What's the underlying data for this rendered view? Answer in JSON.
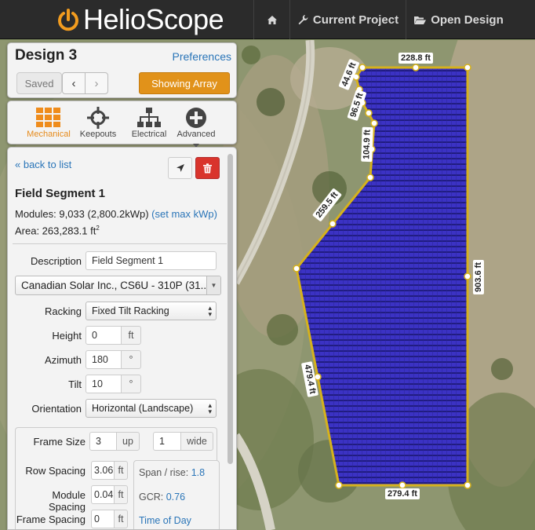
{
  "nav": {
    "brand": "HelioScope",
    "home_icon": "home-icon",
    "current_project_label": "Current Project",
    "open_design_label": "Open Design"
  },
  "design": {
    "title": "Design 3",
    "preferences_label": "Preferences",
    "saved_label": "Saved",
    "prev_label": "‹",
    "next_label": "›",
    "showing_array_label": "Showing Array"
  },
  "tabs": [
    {
      "label": "Mechanical",
      "icon": "grid-icon",
      "active": true
    },
    {
      "label": "Keepouts",
      "icon": "crosshair-icon",
      "active": false
    },
    {
      "label": "Electrical",
      "icon": "hierarchy-icon",
      "active": false
    },
    {
      "label": "Advanced",
      "icon": "plus-circle-icon",
      "active": false
    }
  ],
  "segment": {
    "back_label": "« back to list",
    "title": "Field Segment 1",
    "modules_prefix": "Modules: 9,033 (2,800.2kWp)",
    "set_max_label": "(set max kWp)",
    "area_text": "Area: 263,283.1 ft",
    "area_sup": "2",
    "description_label": "Description",
    "description_value": "Field Segment 1",
    "module_value": "Canadian Solar Inc., CS6U - 310P (31...",
    "racking_label": "Racking",
    "racking_value": "Fixed Tilt Racking",
    "height_label": "Height",
    "height_value": "0",
    "height_unit": "ft",
    "azimuth_label": "Azimuth",
    "azimuth_value": "180",
    "azimuth_unit": "°",
    "tilt_label": "Tilt",
    "tilt_value": "10",
    "tilt_unit": "°",
    "orientation_label": "Orientation",
    "orientation_value": "Horizontal (Landscape)",
    "frame_size_label": "Frame Size",
    "frame_up_value": "3",
    "frame_up_unit": "up",
    "frame_wide_value": "1",
    "frame_wide_unit": "wide",
    "row_spacing_label": "Row Spacing",
    "row_spacing_value": "3.06",
    "row_spacing_unit": "ft",
    "module_spacing_label": "Module Spacing",
    "module_spacing_value": "0.04",
    "module_spacing_unit": "ft",
    "frame_spacing_label": "Frame Spacing",
    "frame_spacing_value": "0",
    "frame_spacing_unit": "ft",
    "span_rise_label": "Span / rise:",
    "span_rise_value": "1.8",
    "gcr_label": "GCR:",
    "gcr_value": "0.76",
    "time_of_day_label": "Time of Day"
  },
  "map": {
    "array_color": "#2f29b8",
    "outline_color": "#d6b21c",
    "edges": [
      "228.8 ft",
      "44.6 ft",
      "96.5 ft",
      "104.9 ft",
      "259.5 ft",
      "903.6 ft",
      "479.4 ft",
      "279.4 ft"
    ]
  }
}
